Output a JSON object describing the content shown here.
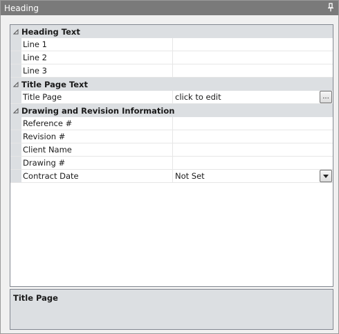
{
  "window": {
    "title": "Heading",
    "pin_icon": "pin-icon"
  },
  "grid": {
    "categories": [
      {
        "label": "Heading Text",
        "rows": [
          {
            "name": "Line 1",
            "value": ""
          },
          {
            "name": "Line 2",
            "value": ""
          },
          {
            "name": "Line 3",
            "value": ""
          }
        ]
      },
      {
        "label": "Title Page Text",
        "rows": [
          {
            "name": "Title Page",
            "value": "click to edit",
            "button": "..."
          }
        ]
      },
      {
        "label": "Drawing and Revision Information",
        "rows": [
          {
            "name": "Reference #",
            "value": ""
          },
          {
            "name": "Revision #",
            "value": ""
          },
          {
            "name": "Client Name",
            "value": ""
          },
          {
            "name": "Drawing #",
            "value": ""
          },
          {
            "name": "Contract Date",
            "value": "Not Set"
          }
        ]
      }
    ]
  },
  "description": {
    "title": "Title Page"
  }
}
